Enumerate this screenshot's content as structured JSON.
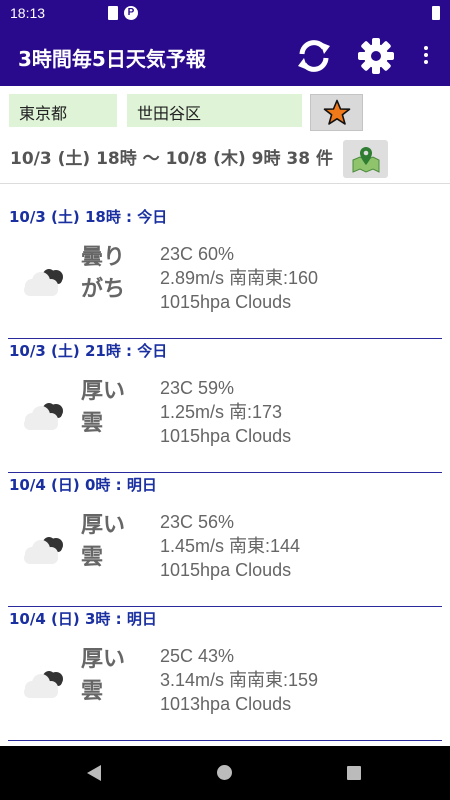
{
  "status_bar": {
    "time": "18:13",
    "notification_icons": [
      "sd-card-icon",
      "p-icon"
    ],
    "p_glyph": "P",
    "battery_icon": "battery-icon"
  },
  "app_bar": {
    "title": "3時間毎5日天気予報",
    "icons": [
      "refresh-icon",
      "settings-icon",
      "more-vert-icon"
    ]
  },
  "location": {
    "prefecture": "東京都",
    "ward": "世田谷区",
    "favorite_icon": "star-icon"
  },
  "range": {
    "text": "10/3 (土) 18時 〜 10/8 (木) 9時 38 件",
    "map_icon": "map-pin-icon"
  },
  "colors": {
    "primary": "#2a0a8c",
    "field_bg": "#dff3d6",
    "header_text": "#1a2fa0",
    "star_orange": "#f07a1a"
  },
  "forecasts": [
    {
      "header": "10/3 (土) 18時 : 今日",
      "condition": "曇りがち",
      "temp_humidity": "23C 60%",
      "wind": "2.89m/s 南南東:160",
      "pressure": "1015hpa Clouds",
      "icon": "cloud-icon"
    },
    {
      "header": "10/3 (土) 21時 : 今日",
      "condition": "厚い雲",
      "temp_humidity": "23C 59%",
      "wind": "1.25m/s 南:173",
      "pressure": "1015hpa Clouds",
      "icon": "cloud-icon"
    },
    {
      "header": "10/4 (日) 0時 : 明日",
      "condition": "厚い雲",
      "temp_humidity": "23C 56%",
      "wind": "1.45m/s 南東:144",
      "pressure": "1015hpa Clouds",
      "icon": "cloud-icon"
    },
    {
      "header": "10/4 (日) 3時 : 明日",
      "condition": "厚い雲",
      "temp_humidity": "25C 43%",
      "wind": "3.14m/s 南南東:159",
      "pressure": "1013hpa Clouds",
      "icon": "cloud-icon"
    }
  ],
  "nav_bar": {
    "icons": [
      "back-icon",
      "home-icon",
      "recents-icon"
    ]
  }
}
